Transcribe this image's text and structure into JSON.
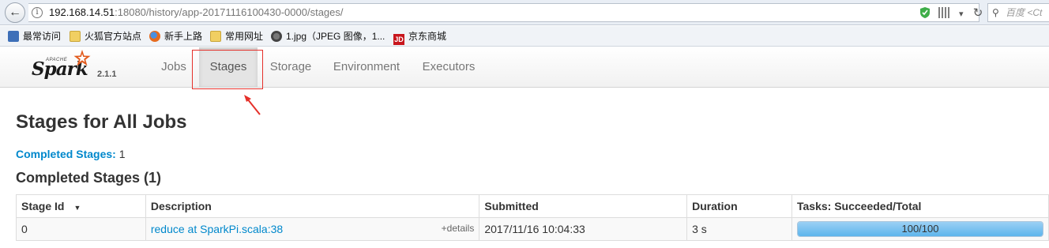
{
  "browser": {
    "url_host": "192.168.14.51",
    "url_path": ":18080/history/app-20171116100430-0000/stages/",
    "search_placeholder": "百度 <Ct",
    "bookmarks": [
      {
        "label": "最常访问",
        "icon": "recent-icon"
      },
      {
        "label": "火狐官方站点",
        "icon": "folder-icon"
      },
      {
        "label": "新手上路",
        "icon": "firefox-icon"
      },
      {
        "label": "常用网址",
        "icon": "folder-icon"
      },
      {
        "label": "1.jpg（JPEG 图像，1...",
        "icon": "globe-icon"
      },
      {
        "label": "京东商城",
        "icon": "jd-icon"
      }
    ]
  },
  "logo": {
    "apache": "APACHE",
    "spark": "Spark",
    "version": "2.1.1"
  },
  "nav": {
    "items": [
      {
        "label": "Jobs"
      },
      {
        "label": "Stages",
        "active": true
      },
      {
        "label": "Storage"
      },
      {
        "label": "Environment"
      },
      {
        "label": "Executors"
      }
    ]
  },
  "page": {
    "title": "Stages for All Jobs",
    "summary_link": "Completed Stages:",
    "summary_count": "1",
    "section_title": "Completed Stages (1)"
  },
  "table": {
    "headers": [
      "Stage Id",
      "Description",
      "Submitted",
      "Duration",
      "Tasks: Succeeded/Total"
    ],
    "rows": [
      {
        "stage_id": "0",
        "description": "reduce at SparkPi.scala:38",
        "details": "+details",
        "submitted": "2017/11/16 10:04:33",
        "duration": "3 s",
        "tasks_text": "100/100",
        "tasks_fraction": 1.0
      }
    ]
  },
  "colors": {
    "link": "#0088cc",
    "annotation": "#e5302a",
    "progress": "#5db5ec"
  }
}
